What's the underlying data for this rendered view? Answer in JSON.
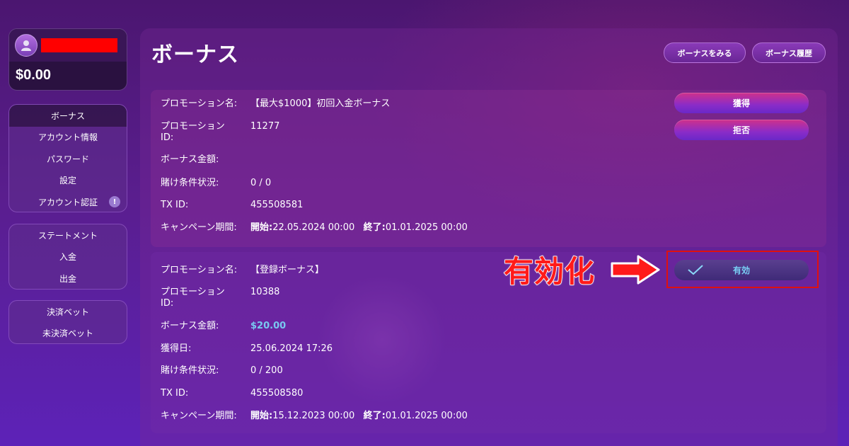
{
  "user": {
    "balance": "$0.00"
  },
  "sidebar": {
    "account_menu": [
      {
        "label": "ボーナス",
        "active": true
      },
      {
        "label": "アカウント情報"
      },
      {
        "label": "パスワード"
      },
      {
        "label": "設定"
      },
      {
        "label": "アカウント認証",
        "badge": "!"
      }
    ],
    "statement_menu": [
      {
        "label": "ステートメント"
      },
      {
        "label": "入金"
      },
      {
        "label": "出金"
      }
    ],
    "bets_menu": [
      {
        "label": "決済ベット"
      },
      {
        "label": "未決済ベット"
      }
    ]
  },
  "header": {
    "title": "ボーナス",
    "view_bonus_label": "ボーナスをみる",
    "bonus_history_label": "ボーナス履歴"
  },
  "labels": {
    "promo_name": "プロモーション名:",
    "promo_id": "プロモーション\nID:",
    "bonus_amount": "ボーナス金額:",
    "acquired_date": "獲得日:",
    "wager_status": "賭け条件状況:",
    "tx_id": "TX ID:",
    "campaign_period": "キャンペーン期間:",
    "start": "開始:",
    "end": "終了:"
  },
  "bonuses": [
    {
      "promo_name": "【最大$1000】初回入金ボーナス",
      "promo_id": "11277",
      "bonus_amount": "",
      "wager_status": "0 / 0",
      "tx_id": "455508581",
      "start": "22.05.2024 00:00",
      "end": "01.01.2025 00:00",
      "claim_label": "獲得",
      "reject_label": "拒否"
    },
    {
      "promo_name": "【登録ボーナス】",
      "promo_id": "10388",
      "bonus_amount": "$20.00",
      "acquired_date": "25.06.2024 17:26",
      "wager_status": "0 / 200",
      "tx_id": "455508580",
      "start": "15.12.2023 00:00",
      "end": "01.01.2025 00:00",
      "active_label": "有効"
    }
  ],
  "annotation": {
    "text": "有効化",
    "color": "#ff1a1a"
  },
  "colors": {
    "money": "#79c8f0",
    "annotation_border": "#e01010"
  }
}
